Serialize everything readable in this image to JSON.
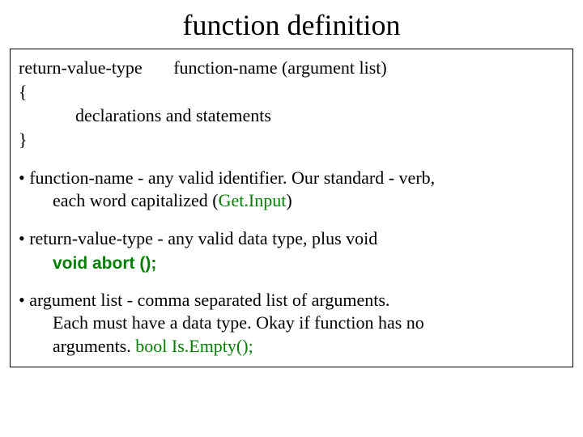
{
  "title": "function definition",
  "syntax": {
    "line1": "return-value-type       function-name (argument list)",
    "open": "{",
    "decl": "declarations and statements",
    "close": "}"
  },
  "bullets": {
    "b1_a": "function-name - any valid identifier. Our standard - verb,",
    "b1_b": "each word capitalized (",
    "b1_c": "Get.Input",
    "b1_d": ")",
    "b2_a": "return-value-type - any valid data type, plus void",
    "b2_void": "void  abort ();",
    "b3_a": "argument list - comma separated list of arguments.",
    "b3_b": "Each must have a data type. Okay if function has no",
    "b3_c": "arguments. ",
    "b3_d": "bool Is.Empty();"
  }
}
